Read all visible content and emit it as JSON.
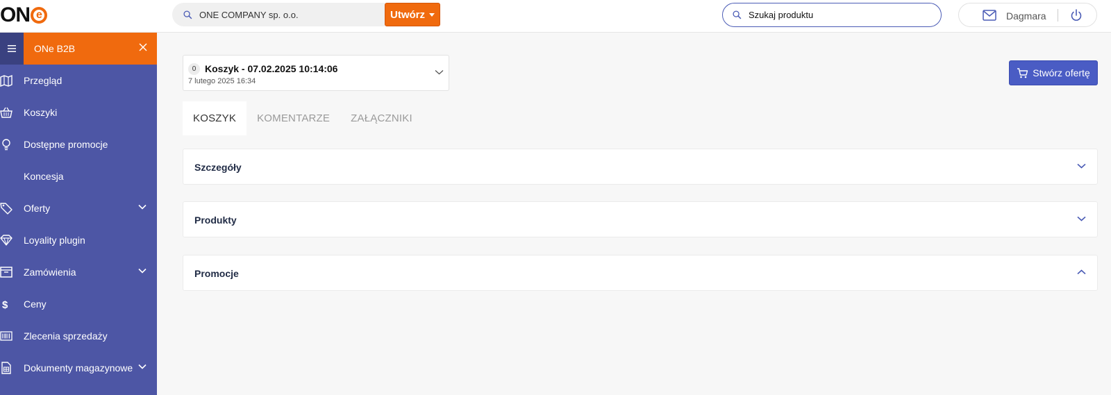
{
  "logo": {
    "text_on": "ON",
    "text_e": "e"
  },
  "header": {
    "company": "ONE COMPANY sp. o.o.",
    "create_label": "Utwórz",
    "product_search_placeholder": "Szukaj produktu",
    "user_name": "Dagmara"
  },
  "sidebar": {
    "title": "ONe B2B",
    "items": [
      {
        "label": "Przegląd",
        "icon": "map-icon",
        "has_submenu": false
      },
      {
        "label": "Koszyki",
        "icon": "basket-icon",
        "has_submenu": false
      },
      {
        "label": "Dostępne promocje",
        "icon": "lightbulb-icon",
        "has_submenu": false
      },
      {
        "label": "Koncesja",
        "icon": "",
        "has_submenu": false
      },
      {
        "label": "Oferty",
        "icon": "tag-icon",
        "has_submenu": true
      },
      {
        "label": "Loyality plugin",
        "icon": "diamond-icon",
        "has_submenu": false
      },
      {
        "label": "Zamówienia",
        "icon": "archive-icon",
        "has_submenu": true
      },
      {
        "label": "Ceny",
        "icon": "dollar-icon",
        "has_submenu": false
      },
      {
        "label": "Zlecenia sprzedaży",
        "icon": "barcode-icon",
        "has_submenu": false
      },
      {
        "label": "Dokumenty magazynowe",
        "icon": "document-icon",
        "has_submenu": true
      }
    ]
  },
  "cart": {
    "count": "0",
    "title": "Koszyk - 07.02.2025 10:14:06",
    "date": "7 lutego 2025 16:34"
  },
  "create_offer_label": "Stwórz ofertę",
  "tabs": [
    {
      "label": "KOSZYK",
      "active": true
    },
    {
      "label": "KOMENTARZE",
      "active": false
    },
    {
      "label": "ZAŁĄCZNIKI",
      "active": false
    }
  ],
  "panels": [
    {
      "title": "Szczegóły",
      "expanded": false
    },
    {
      "title": "Produkty",
      "expanded": false
    },
    {
      "title": "Promocje",
      "expanded": true
    }
  ],
  "colors": {
    "brand_orange": "#f06a0e",
    "sidebar_bg": "#4d56a5",
    "primary_button": "#4a5cc4"
  }
}
